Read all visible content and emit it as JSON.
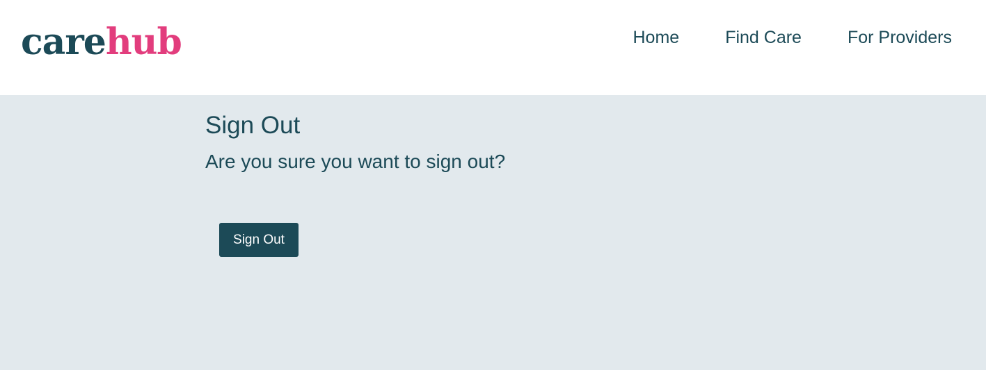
{
  "header": {
    "logo_part1": "care",
    "logo_part2": "hub",
    "nav": {
      "home": "Home",
      "find_care": "Find Care",
      "for_providers": "For Providers"
    }
  },
  "main": {
    "title": "Sign Out",
    "prompt": "Are you sure you want to sign out?",
    "signout_button": "Sign Out"
  },
  "colors": {
    "brand_dark": "#1c4a57",
    "brand_pink": "#e23d7d",
    "panel_bg": "#e2e9ed"
  }
}
